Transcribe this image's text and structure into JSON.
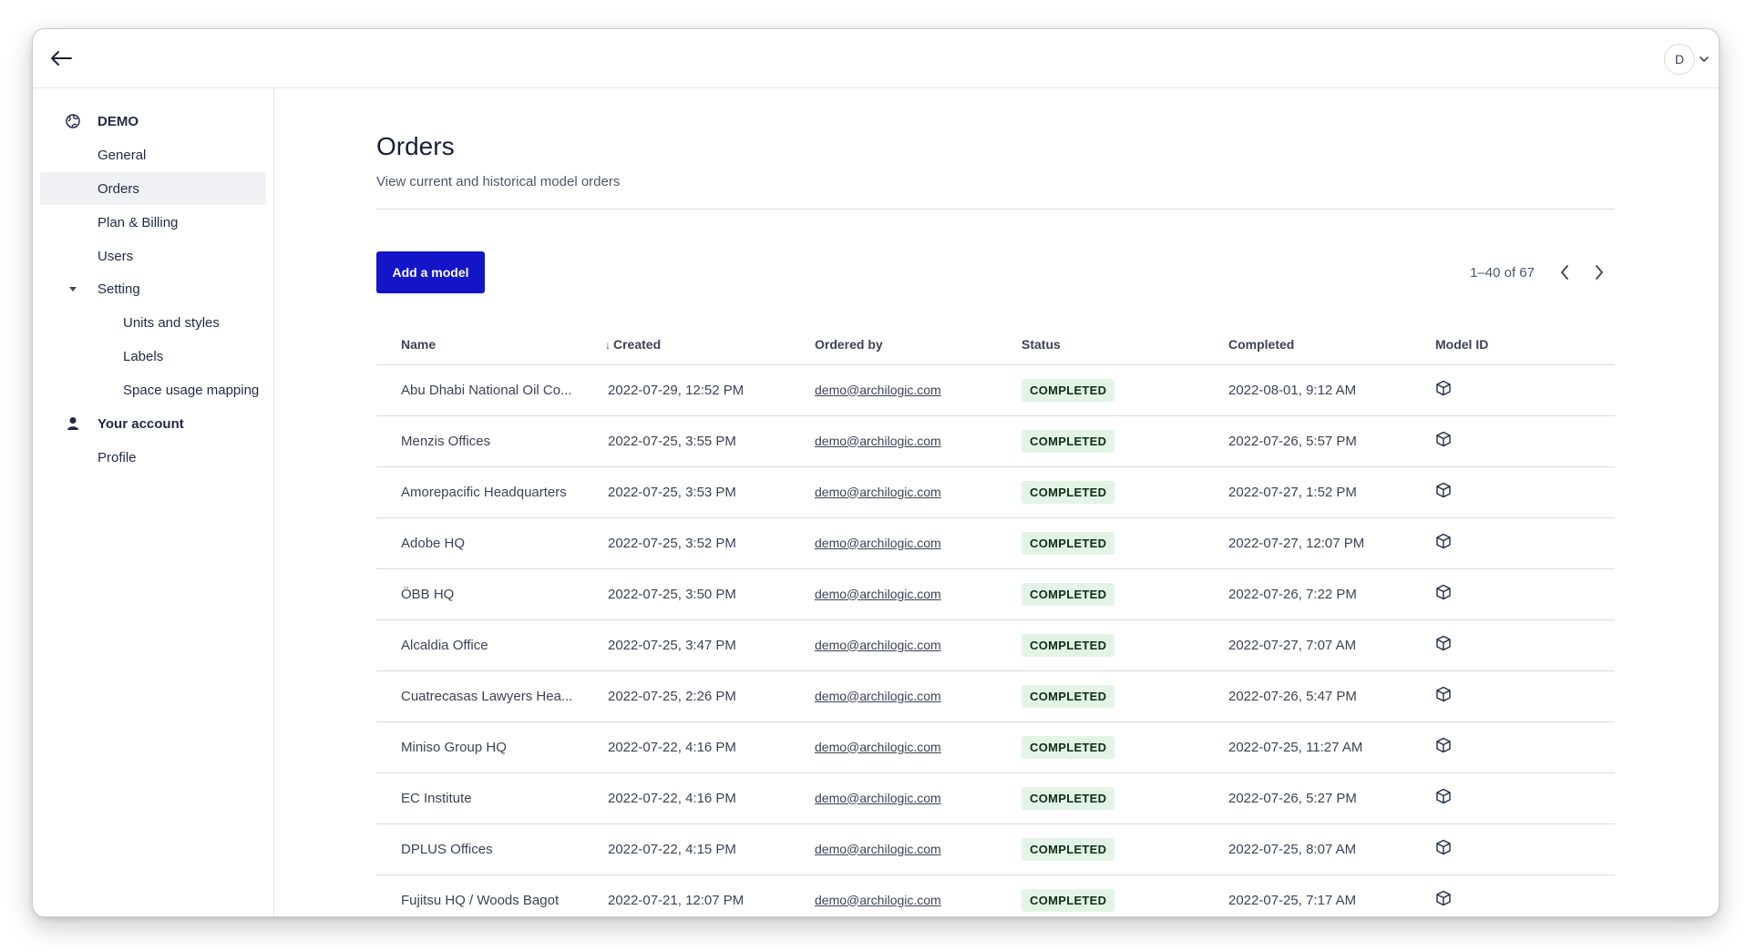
{
  "user": {
    "avatar_initial": "D"
  },
  "sidebar": {
    "org_name": "DEMO",
    "items": [
      "General",
      "Orders",
      "Plan & Billing",
      "Users"
    ],
    "setting_label": "Setting",
    "setting_items": [
      "Units and styles",
      "Labels",
      "Space usage mapping"
    ],
    "account_label": "Your account",
    "account_items": [
      "Profile"
    ],
    "active_item": "Orders"
  },
  "main": {
    "title": "Orders",
    "subtitle": "View current and historical model orders",
    "add_button_label": "Add a model",
    "pagination": "1–40 of 67"
  },
  "table": {
    "columns": [
      "Name",
      "Created",
      "Ordered by",
      "Status",
      "Completed",
      "Model ID"
    ],
    "sort_column": "Created",
    "rows": [
      {
        "name": "Abu Dhabi National Oil Co...",
        "created": "2022-07-29, 12:52 PM",
        "ordered_by": "demo@archilogic.com",
        "status": "COMPLETED",
        "completed": "2022-08-01, 9:12 AM"
      },
      {
        "name": "Menzis Offices",
        "created": "2022-07-25, 3:55 PM",
        "ordered_by": "demo@archilogic.com",
        "status": "COMPLETED",
        "completed": "2022-07-26, 5:57 PM"
      },
      {
        "name": "Amorepacific Headquarters",
        "created": "2022-07-25, 3:53 PM",
        "ordered_by": "demo@archilogic.com",
        "status": "COMPLETED",
        "completed": "2022-07-27, 1:52 PM"
      },
      {
        "name": "Adobe HQ",
        "created": "2022-07-25, 3:52 PM",
        "ordered_by": "demo@archilogic.com",
        "status": "COMPLETED",
        "completed": "2022-07-27, 12:07 PM"
      },
      {
        "name": "ÖBB HQ",
        "created": "2022-07-25, 3:50 PM",
        "ordered_by": "demo@archilogic.com",
        "status": "COMPLETED",
        "completed": "2022-07-26, 7:22 PM"
      },
      {
        "name": "Alcaldia Office",
        "created": "2022-07-25, 3:47 PM",
        "ordered_by": "demo@archilogic.com",
        "status": "COMPLETED",
        "completed": "2022-07-27, 7:07 AM"
      },
      {
        "name": "Cuatrecasas Lawyers Hea...",
        "created": "2022-07-25, 2:26 PM",
        "ordered_by": "demo@archilogic.com",
        "status": "COMPLETED",
        "completed": "2022-07-26, 5:47 PM"
      },
      {
        "name": "Miniso Group HQ",
        "created": "2022-07-22, 4:16 PM",
        "ordered_by": "demo@archilogic.com",
        "status": "COMPLETED",
        "completed": "2022-07-25, 11:27 AM"
      },
      {
        "name": "EC Institute",
        "created": "2022-07-22, 4:16 PM",
        "ordered_by": "demo@archilogic.com",
        "status": "COMPLETED",
        "completed": "2022-07-26, 5:27 PM"
      },
      {
        "name": "DPLUS Offices",
        "created": "2022-07-22, 4:15 PM",
        "ordered_by": "demo@archilogic.com",
        "status": "COMPLETED",
        "completed": "2022-07-25, 8:07 AM"
      },
      {
        "name": "Fujitsu HQ / Woods Bagot",
        "created": "2022-07-21, 12:07 PM",
        "ordered_by": "demo@archilogic.com",
        "status": "COMPLETED",
        "completed": "2022-07-25, 7:17 AM"
      }
    ]
  },
  "colors": {
    "primary_button": "#1414c8",
    "status_badge_bg": "#e3f4e6",
    "active_nav_bg": "#f0f1f4"
  },
  "icons": {
    "back": "arrow-left-icon",
    "org": "globe-icon",
    "account": "person-icon",
    "model": "cube-icon"
  }
}
